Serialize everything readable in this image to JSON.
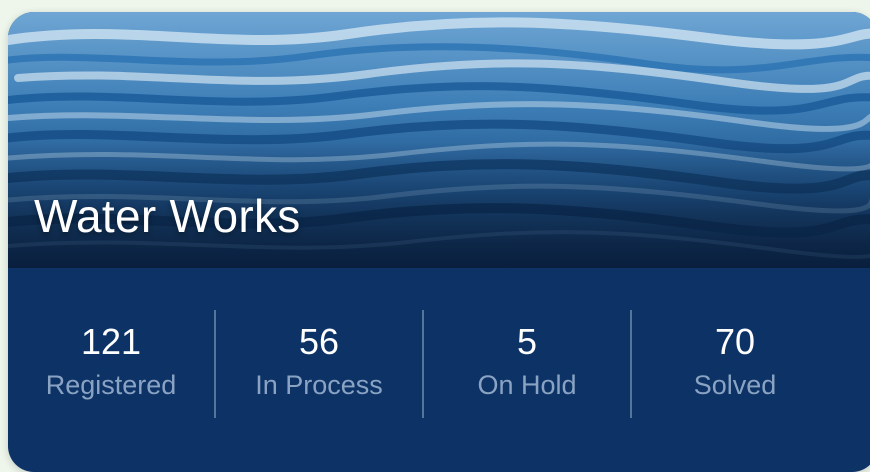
{
  "card": {
    "title": "Water Works",
    "hero_image": "ocean-waves"
  },
  "stats": [
    {
      "value": "121",
      "label": "Registered"
    },
    {
      "value": "56",
      "label": "In Process"
    },
    {
      "value": "5",
      "label": "On Hold"
    },
    {
      "value": "70",
      "label": "Solved"
    }
  ],
  "colors": {
    "panel": "#0c3266",
    "value_text": "#ffffff",
    "label_text": "#8aa3c3",
    "page_background": "#eef6ec"
  }
}
